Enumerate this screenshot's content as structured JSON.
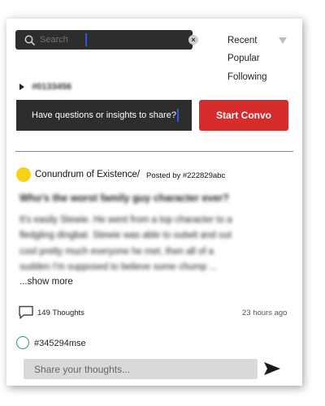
{
  "search": {
    "placeholder": "Search"
  },
  "filter_menu": {
    "items": [
      "Recent",
      "Popular",
      "Following"
    ]
  },
  "tag": {
    "label": "#0133456"
  },
  "ask": {
    "text": "Have questions or insights to share?",
    "button": "Start Convo"
  },
  "post": {
    "topic": "Conundrum of Existence/",
    "posted_by": "Posted by #222829abc",
    "title": "Who's the worst family guy character ever?",
    "body_lines": [
      "It's easily Stewie. He went from a top character to a",
      "fledgling dingbat. Stewie was able to outwit and out",
      "cool pretty much everyone he met, then all of a",
      "sudden I'm supposed to believe some chump ..."
    ],
    "show_more": "...show more",
    "thoughts_count": "149 Thoughts",
    "time": "23 hours ago"
  },
  "reply": {
    "user": "#345294mse",
    "placeholder": "Share your thoughts..."
  },
  "colors": {
    "accent_red": "#d72c2c",
    "yellow_dot": "#f7d21a",
    "dark": "#2d2d2d",
    "caret_blue": "#2f5bd9",
    "teal": "#2f8f86"
  }
}
